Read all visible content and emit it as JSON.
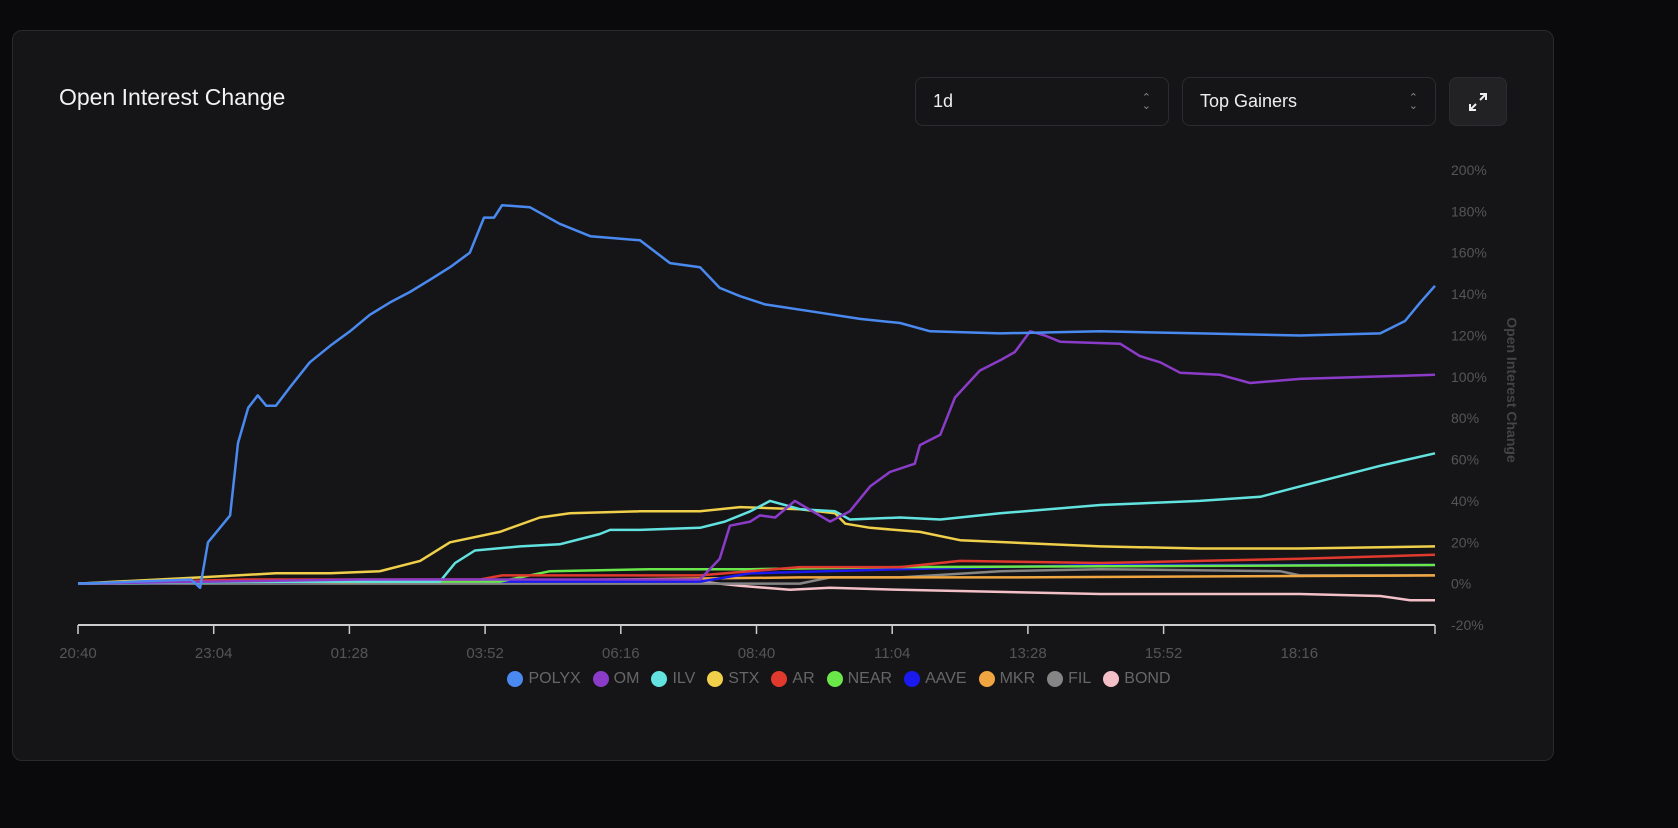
{
  "header": {
    "title": "Open Interest Change",
    "timeframe": "1d",
    "filter": "Top Gainers"
  },
  "chart_data": {
    "type": "line",
    "title": "Open Interest Change",
    "ylabel": "Open Interest Change",
    "xlabel": "",
    "x_unit": "hours since 20:40",
    "xlim": [
      0,
      24
    ],
    "ylim": [
      -20,
      200
    ],
    "x_ticks": [
      0,
      2.4,
      4.8,
      7.2,
      9.6,
      12,
      14.4,
      16.8,
      19.2
    ],
    "x_tick_labels": [
      "20:40",
      "23:04",
      "01:28",
      "03:52",
      "06:16",
      "08:40",
      "11:04",
      "13:28",
      "15:52",
      "18:16"
    ],
    "y_ticks": [
      -20,
      0,
      20,
      40,
      60,
      80,
      100,
      120,
      140,
      160,
      180,
      200
    ],
    "y_tick_labels": [
      "-20%",
      "0%",
      "20%",
      "40%",
      "60%",
      "80%",
      "100%",
      "120%",
      "140%",
      "160%",
      "180%",
      "200%"
    ],
    "legend_position": "bottom",
    "series": [
      {
        "name": "POLYX",
        "color": "#4a8af0",
        "points": [
          [
            0,
            0
          ],
          [
            0.99,
            1
          ],
          [
            2.0,
            2
          ],
          [
            2.16,
            -2
          ],
          [
            2.3,
            20
          ],
          [
            2.69,
            33
          ],
          [
            2.83,
            68
          ],
          [
            3.01,
            85
          ],
          [
            3.18,
            91
          ],
          [
            3.33,
            86
          ],
          [
            3.5,
            86
          ],
          [
            3.75,
            95
          ],
          [
            4.1,
            107
          ],
          [
            4.46,
            115
          ],
          [
            4.81,
            122
          ],
          [
            5.16,
            130
          ],
          [
            5.52,
            136
          ],
          [
            5.87,
            141
          ],
          [
            6.23,
            147
          ],
          [
            6.58,
            153
          ],
          [
            6.93,
            160
          ],
          [
            7.18,
            177
          ],
          [
            7.36,
            177
          ],
          [
            7.5,
            183
          ],
          [
            7.99,
            182
          ],
          [
            8.52,
            174
          ],
          [
            9.06,
            168
          ],
          [
            9.94,
            166
          ],
          [
            10.47,
            155
          ],
          [
            11.0,
            153
          ],
          [
            11.35,
            143
          ],
          [
            11.71,
            139
          ],
          [
            12.15,
            135
          ],
          [
            13.12,
            131
          ],
          [
            13.83,
            128
          ],
          [
            14.54,
            126
          ],
          [
            15.07,
            122
          ],
          [
            16.31,
            121
          ],
          [
            18.08,
            122
          ],
          [
            19.84,
            121
          ],
          [
            21.61,
            120
          ],
          [
            23.03,
            121
          ],
          [
            23.47,
            127
          ],
          [
            23.74,
            136
          ],
          [
            24,
            144
          ]
        ]
      },
      {
        "name": "OM",
        "color": "#8a3cc8",
        "points": [
          [
            0,
            0
          ],
          [
            5,
            2
          ],
          [
            11.0,
            2
          ],
          [
            11.35,
            12
          ],
          [
            11.53,
            28
          ],
          [
            11.89,
            30
          ],
          [
            12.06,
            33
          ],
          [
            12.33,
            32
          ],
          [
            12.68,
            40
          ],
          [
            13.3,
            30
          ],
          [
            13.65,
            35
          ],
          [
            14.01,
            47
          ],
          [
            14.36,
            54
          ],
          [
            14.8,
            58
          ],
          [
            14.89,
            67
          ],
          [
            15.25,
            72
          ],
          [
            15.51,
            90
          ],
          [
            15.95,
            103
          ],
          [
            16.31,
            108
          ],
          [
            16.57,
            112
          ],
          [
            16.84,
            122
          ],
          [
            17.1,
            120
          ],
          [
            17.37,
            117
          ],
          [
            18.43,
            116
          ],
          [
            18.78,
            110
          ],
          [
            19.14,
            107
          ],
          [
            19.49,
            102
          ],
          [
            20.2,
            101
          ],
          [
            20.73,
            97
          ],
          [
            21.61,
            99
          ],
          [
            24,
            101
          ]
        ]
      },
      {
        "name": "ILV",
        "color": "#62e3e0",
        "points": [
          [
            0,
            0
          ],
          [
            3,
            1
          ],
          [
            6.4,
            1
          ],
          [
            6.67,
            10
          ],
          [
            7.02,
            16
          ],
          [
            7.82,
            18
          ],
          [
            8.52,
            19
          ],
          [
            9.23,
            24
          ],
          [
            9.41,
            26
          ],
          [
            9.94,
            26
          ],
          [
            11.0,
            27
          ],
          [
            11.44,
            30
          ],
          [
            11.89,
            35
          ],
          [
            12.24,
            40
          ],
          [
            12.77,
            36
          ],
          [
            13.39,
            35
          ],
          [
            13.65,
            31
          ],
          [
            14.54,
            32
          ],
          [
            15.25,
            31
          ],
          [
            16.31,
            34
          ],
          [
            18.08,
            38
          ],
          [
            19.84,
            40
          ],
          [
            20.91,
            42
          ],
          [
            21.61,
            47
          ],
          [
            23.03,
            57
          ],
          [
            24,
            63
          ]
        ]
      },
      {
        "name": "STX",
        "color": "#f0cf4a",
        "points": [
          [
            0,
            0
          ],
          [
            2.16,
            3
          ],
          [
            3.5,
            5
          ],
          [
            4.46,
            5
          ],
          [
            5.34,
            6
          ],
          [
            6.05,
            11
          ],
          [
            6.58,
            20
          ],
          [
            7.46,
            25
          ],
          [
            8.17,
            32
          ],
          [
            8.7,
            34
          ],
          [
            9.94,
            35
          ],
          [
            11.0,
            35
          ],
          [
            11.71,
            37
          ],
          [
            12.77,
            36
          ],
          [
            13.39,
            34
          ],
          [
            13.57,
            29
          ],
          [
            14.01,
            27
          ],
          [
            14.89,
            25
          ],
          [
            15.6,
            21
          ],
          [
            17.19,
            19
          ],
          [
            18.08,
            18
          ],
          [
            19.84,
            17
          ],
          [
            21.61,
            17
          ],
          [
            24,
            18
          ]
        ]
      },
      {
        "name": "AR",
        "color": "#e03a2e",
        "points": [
          [
            0,
            0
          ],
          [
            3,
            2
          ],
          [
            7.11,
            2
          ],
          [
            7.5,
            4
          ],
          [
            11.0,
            4
          ],
          [
            12.77,
            8
          ],
          [
            14.54,
            8
          ],
          [
            15.6,
            11
          ],
          [
            18.08,
            10
          ],
          [
            19.84,
            11
          ],
          [
            21.61,
            12
          ],
          [
            24,
            14
          ]
        ]
      },
      {
        "name": "NEAR",
        "color": "#6ae84a",
        "points": [
          [
            0,
            0
          ],
          [
            4,
            1
          ],
          [
            7.46,
            1
          ],
          [
            8.35,
            6
          ],
          [
            10.12,
            7
          ],
          [
            11.89,
            7
          ],
          [
            14.54,
            8
          ],
          [
            24,
            9
          ]
        ]
      },
      {
        "name": "AAVE",
        "color": "#1a1af0",
        "points": [
          [
            0,
            0
          ],
          [
            5,
            1
          ],
          [
            11.0,
            1
          ],
          [
            11.89,
            5
          ],
          [
            14.54,
            7
          ],
          [
            18.08,
            9
          ],
          [
            24,
            9
          ]
        ]
      },
      {
        "name": "MKR",
        "color": "#f0a640",
        "points": [
          [
            0,
            0
          ],
          [
            6,
            1
          ],
          [
            12.77,
            3
          ],
          [
            16.31,
            3
          ],
          [
            24,
            4
          ]
        ]
      },
      {
        "name": "FIL",
        "color": "#858585",
        "points": [
          [
            0,
            0
          ],
          [
            6,
            0
          ],
          [
            12.77,
            0
          ],
          [
            13.3,
            3
          ],
          [
            14.54,
            3
          ],
          [
            16.31,
            6
          ],
          [
            18.08,
            7
          ],
          [
            21.26,
            6
          ],
          [
            21.61,
            4
          ],
          [
            24,
            4
          ]
        ]
      },
      {
        "name": "BOND",
        "color": "#f4c0c8",
        "points": [
          [
            0,
            0
          ],
          [
            6,
            1
          ],
          [
            11.0,
            1
          ],
          [
            11.71,
            -1
          ],
          [
            12.59,
            -3
          ],
          [
            13.3,
            -2
          ],
          [
            14.54,
            -3
          ],
          [
            16.31,
            -4
          ],
          [
            18.08,
            -5
          ],
          [
            19.84,
            -5
          ],
          [
            21.61,
            -5
          ],
          [
            23.03,
            -6
          ],
          [
            23.56,
            -8
          ],
          [
            24,
            -8
          ]
        ]
      }
    ]
  }
}
